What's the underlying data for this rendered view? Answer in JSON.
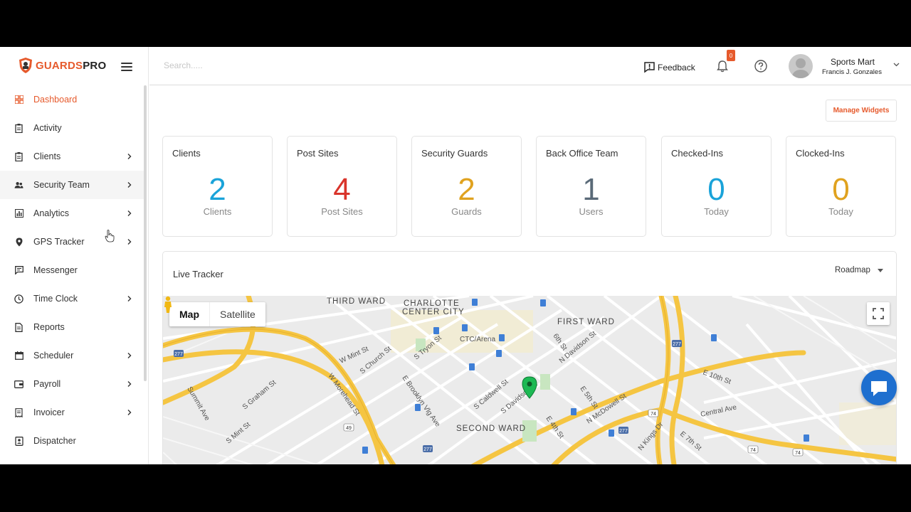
{
  "brand": {
    "name_accent": "GUARDS",
    "name_rest": "PRO"
  },
  "sidebar": {
    "items": [
      {
        "label": "Dashboard",
        "icon": "dashboard-icon",
        "active": true,
        "chevron": false
      },
      {
        "label": "Activity",
        "icon": "clipboard-icon",
        "chevron": false
      },
      {
        "label": "Clients",
        "icon": "clipboard-icon",
        "chevron": true
      },
      {
        "label": "Security Team",
        "icon": "users-icon",
        "chevron": true
      },
      {
        "label": "Analytics",
        "icon": "bar-chart-icon",
        "chevron": true
      },
      {
        "label": "GPS Tracker",
        "icon": "map-pin-icon",
        "chevron": true
      },
      {
        "label": "Messenger",
        "icon": "chat-icon",
        "chevron": false
      },
      {
        "label": "Time Clock",
        "icon": "clock-icon",
        "chevron": true
      },
      {
        "label": "Reports",
        "icon": "document-icon",
        "chevron": false
      },
      {
        "label": "Scheduler",
        "icon": "calendar-icon",
        "chevron": true
      },
      {
        "label": "Payroll",
        "icon": "wallet-icon",
        "chevron": true
      },
      {
        "label": "Invoicer",
        "icon": "receipt-icon",
        "chevron": true
      },
      {
        "label": "Dispatcher",
        "icon": "dispatch-icon",
        "chevron": false
      }
    ]
  },
  "header": {
    "search_placeholder": "Search.....",
    "feedback_label": "Feedback",
    "notification_count": "0",
    "user_org": "Sports Mart",
    "user_name": "Francis J. Gonzales"
  },
  "main": {
    "manage_widgets_label": "Manage Widgets",
    "stats": [
      {
        "title": "Clients",
        "value": "2",
        "sub": "Clients",
        "color": "#1aa3d9"
      },
      {
        "title": "Post Sites",
        "value": "4",
        "sub": "Post Sites",
        "color": "#d9342b"
      },
      {
        "title": "Security Guards",
        "value": "2",
        "sub": "Guards",
        "color": "#e0a21f"
      },
      {
        "title": "Back Office Team",
        "value": "1",
        "sub": "Users",
        "color": "#5a6a78"
      },
      {
        "title": "Checked-Ins",
        "value": "0",
        "sub": "Today",
        "color": "#1aa3d9"
      },
      {
        "title": "Clocked-Ins",
        "value": "0",
        "sub": "Today",
        "color": "#e0a21f"
      }
    ],
    "tracker": {
      "title": "Live Tracker",
      "map_type": "Roadmap",
      "map_label": "Map",
      "satellite_label": "Satellite",
      "labels": {
        "third_ward": "THIRD WARD",
        "charlotte": "CHARLOTTE",
        "center_city": "CENTER CITY",
        "first_ward": "FIRST WARD",
        "second_ward": "SECOND WARD",
        "ctc_arena": "CTC/Arena",
        "w_mint": "W Mint St",
        "w_morehead": "W Morehead St",
        "s_church": "S Church St",
        "s_tryon": "S Tryon St",
        "e_brooklyn": "E Brooklyn Vlg Ave",
        "s_caldwell": "S Caldwell St",
        "s_davidson": "S Davidson St",
        "n_davidson": "N Davidson St",
        "n_mcdowell": "N McDowell St",
        "central_ave": "Central Ave",
        "e_10th": "E 10th St",
        "e_7th": "E 7th St",
        "e_4th": "E 4th St",
        "e_5th": "E 5th St",
        "e_6th": "6th St",
        "n_kings": "N Kings Dr",
        "s_mint": "S Mint St",
        "s_graham": "S Graham St",
        "summit": "Summit Ave",
        "hwy_277": "277",
        "hwy_74": "74",
        "hwy_49": "49"
      }
    }
  },
  "colors": {
    "accent": "#e65a2c",
    "highway": "#f5c542",
    "pin": "#1db954",
    "chat": "#1e6fcf"
  }
}
